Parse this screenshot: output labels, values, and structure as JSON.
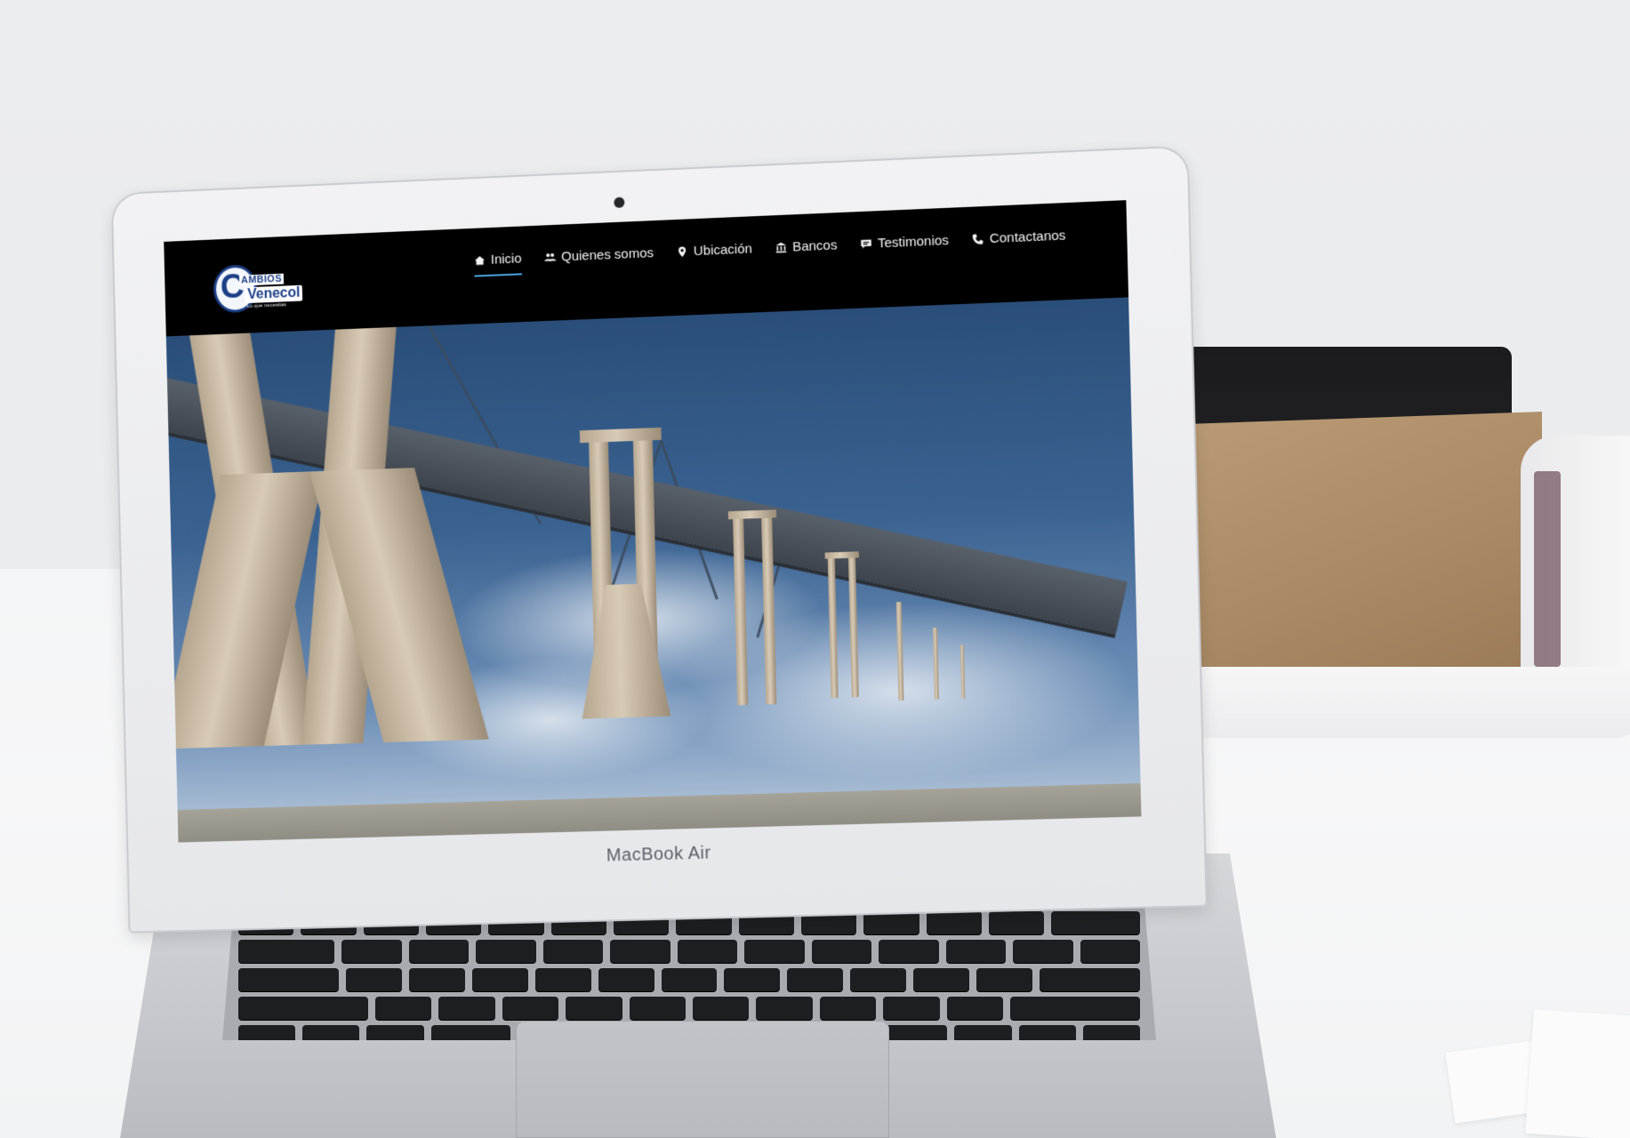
{
  "laptop": {
    "brand_label": "MacBook Air"
  },
  "site": {
    "logo": {
      "initial": "C",
      "word1": "AMBIOS",
      "word2": "Venecol",
      "tagline": "Lo que necesitas"
    },
    "nav": [
      {
        "label": "Inicio",
        "icon": "home-icon",
        "active": true
      },
      {
        "label": "Quienes somos",
        "icon": "users-icon",
        "active": false
      },
      {
        "label": "Ubicación",
        "icon": "map-pin-icon",
        "active": false
      },
      {
        "label": "Bancos",
        "icon": "bank-icon",
        "active": false
      },
      {
        "label": "Testimonios",
        "icon": "chat-icon",
        "active": false
      },
      {
        "label": "Contactanos",
        "icon": "phone-icon",
        "active": false
      }
    ],
    "hero": {
      "image_subject": "bridge-photo"
    },
    "colors": {
      "header_bg": "#000000",
      "nav_text": "#f4f4f4",
      "active_underline": "#4aa3df",
      "logo_blue": "#1c3f86"
    }
  }
}
